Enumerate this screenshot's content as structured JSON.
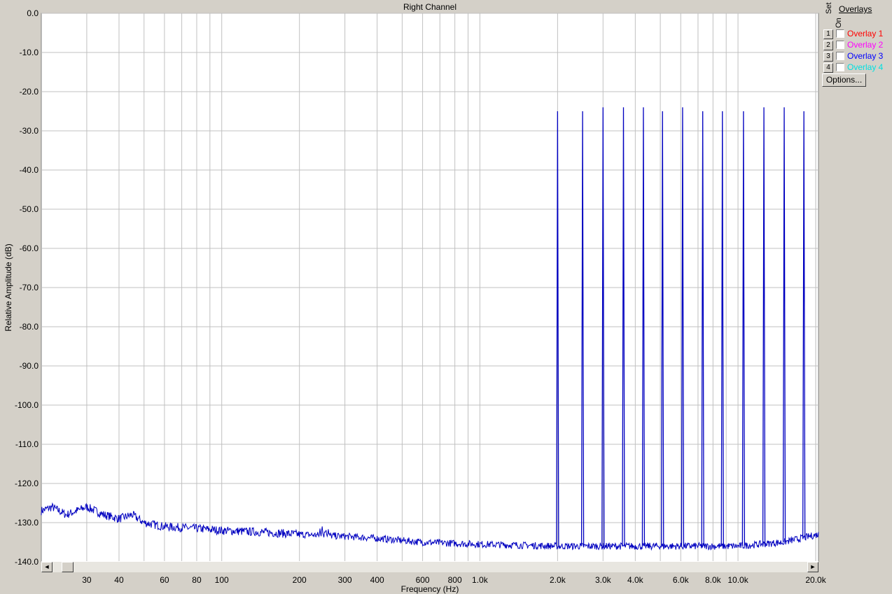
{
  "chart_data": {
    "type": "line",
    "title": "Right Channel",
    "xlabel": "Frequency (Hz)",
    "ylabel": "Relative Amplitude (dB)",
    "xscale": "log",
    "xlim": [
      20,
      20500
    ],
    "ylim": [
      -140,
      0
    ],
    "grid": true,
    "yticks": [
      "0.0",
      "-10.0",
      "-20.0",
      "-30.0",
      "-40.0",
      "-50.0",
      "-60.0",
      "-70.0",
      "-80.0",
      "-90.0",
      "-100.0",
      "-110.0",
      "-120.0",
      "-130.0",
      "-140.0"
    ],
    "ytick_values": [
      0,
      -10,
      -20,
      -30,
      -40,
      -50,
      -60,
      -70,
      -80,
      -90,
      -100,
      -110,
      -120,
      -130,
      -140
    ],
    "xticks": [
      {
        "value": 30,
        "label": "30"
      },
      {
        "value": 40,
        "label": "40"
      },
      {
        "value": 60,
        "label": "60"
      },
      {
        "value": 80,
        "label": "80"
      },
      {
        "value": 100,
        "label": "100"
      },
      {
        "value": 200,
        "label": "200"
      },
      {
        "value": 300,
        "label": "300"
      },
      {
        "value": 400,
        "label": "400"
      },
      {
        "value": 600,
        "label": "600"
      },
      {
        "value": 800,
        "label": "800"
      },
      {
        "value": 1000,
        "label": "1.0k"
      },
      {
        "value": 2000,
        "label": "2.0k"
      },
      {
        "value": 3000,
        "label": "3.0k"
      },
      {
        "value": 4000,
        "label": "4.0k"
      },
      {
        "value": 6000,
        "label": "6.0k"
      },
      {
        "value": 8000,
        "label": "8.0k"
      },
      {
        "value": 10000,
        "label": "10.0k"
      },
      {
        "value": 20000,
        "label": "20.0k"
      }
    ],
    "series": [
      {
        "color": "#0000c0",
        "noise_floor": [
          [
            20,
            -127
          ],
          [
            22,
            -126
          ],
          [
            25,
            -128
          ],
          [
            30,
            -126
          ],
          [
            35,
            -128
          ],
          [
            40,
            -129
          ],
          [
            45,
            -128
          ],
          [
            50,
            -130
          ],
          [
            60,
            -131
          ],
          [
            80,
            -131.5
          ],
          [
            100,
            -132
          ],
          [
            150,
            -132.5
          ],
          [
            200,
            -133
          ],
          [
            300,
            -133.5
          ],
          [
            400,
            -134
          ],
          [
            600,
            -135
          ],
          [
            1000,
            -135.5
          ],
          [
            2000,
            -136
          ],
          [
            5000,
            -136
          ],
          [
            10000,
            -136
          ],
          [
            15000,
            -135
          ],
          [
            20500,
            -133
          ]
        ],
        "peaks": [
          {
            "freq": 2000,
            "db": -25
          },
          {
            "freq": 2500,
            "db": -25
          },
          {
            "freq": 3000,
            "db": -24
          },
          {
            "freq": 3600,
            "db": -24
          },
          {
            "freq": 4300,
            "db": -24
          },
          {
            "freq": 5100,
            "db": -25
          },
          {
            "freq": 6100,
            "db": -24
          },
          {
            "freq": 7300,
            "db": -25
          },
          {
            "freq": 8700,
            "db": -25
          },
          {
            "freq": 10500,
            "db": -25
          },
          {
            "freq": 12600,
            "db": -24
          },
          {
            "freq": 15100,
            "db": -24
          },
          {
            "freq": 18000,
            "db": -25
          }
        ]
      }
    ]
  },
  "scrollbar": {
    "left_arrow": "◄",
    "right_arrow": "►"
  },
  "side_panel": {
    "set_label": "Set",
    "on_label": "On",
    "heading": "Overlays",
    "overlays": [
      {
        "number": "1",
        "name": "Overlay 1",
        "color": "#ff0000",
        "checked": false
      },
      {
        "number": "2",
        "name": "Overlay 2",
        "color": "#ff00ff",
        "checked": false
      },
      {
        "number": "3",
        "name": "Overlay 3",
        "color": "#0000ff",
        "checked": false
      },
      {
        "number": "4",
        "name": "Overlay 4",
        "color": "#00e0e0",
        "checked": false
      }
    ],
    "options_label": "Options..."
  }
}
